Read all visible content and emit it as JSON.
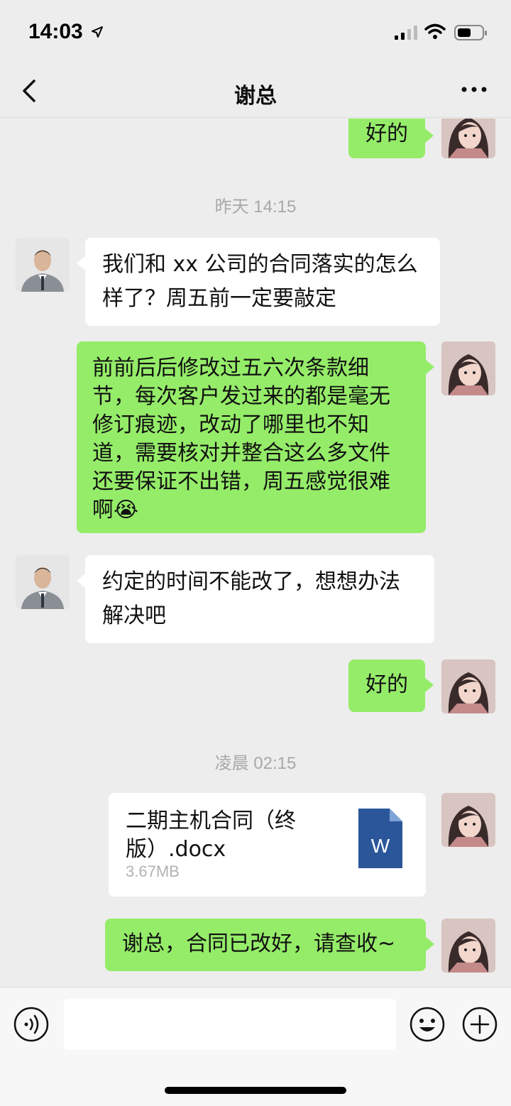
{
  "status_bar": {
    "time": "14:03",
    "icons": [
      "location-arrow-icon",
      "signal-icon",
      "wifi-icon",
      "battery-icon"
    ]
  },
  "nav": {
    "title": "谢总",
    "back_icon": "chevron-left-icon",
    "more_icon": "more-dots-icon"
  },
  "messages": [
    {
      "from": "me",
      "text": "好的"
    },
    {
      "timestamp": "昨天 14:15"
    },
    {
      "from": "other",
      "lines": [
        "我们和 xx 公司的合同落实的怎么",
        "样了？周五前一定要敲定"
      ]
    },
    {
      "from": "me",
      "lines": [
        "前前后后修改过五六次条款细",
        "节，每次客户发过来的都是毫无",
        "修订痕迹，改动了哪里也不知",
        "道，需要核对并整合这么多文件",
        "还要保证不出错，周五感觉很难",
        "啊😭"
      ]
    },
    {
      "from": "other",
      "lines": [
        "约定的时间不能改了，想想办法",
        "解决吧"
      ]
    },
    {
      "from": "me",
      "text": "好的"
    },
    {
      "timestamp": "凌晨 02:15"
    },
    {
      "from": "me",
      "type": "file",
      "file_name_lines": [
        "二期主机合同（终",
        "版）.docx"
      ],
      "file_size": "3.67MB",
      "file_icon_letter": "W"
    },
    {
      "from": "me",
      "text": "谢总，合同已改好，请查收~"
    }
  ],
  "input_bar": {
    "voice_icon": "voice-icon",
    "emoji_icon": "emoji-icon",
    "plus_icon": "plus-icon",
    "placeholder": ""
  },
  "colors": {
    "background": "#ededed",
    "my_bubble": "#95ec69",
    "other_bubble": "#ffffff",
    "word_icon": "#2b579a"
  }
}
